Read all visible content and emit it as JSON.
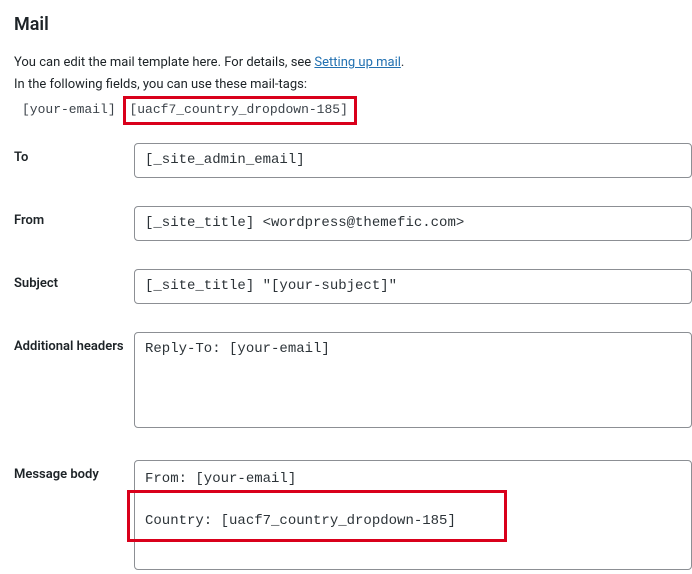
{
  "title": "Mail",
  "intro": {
    "prefix": "You can edit the mail template here. For details, see ",
    "link_text": "Setting up mail",
    "suffix": "."
  },
  "tagline": "In the following fields, you can use these mail-tags:",
  "mail_tags": {
    "tag1": "[your-email]",
    "tag2": "[uacf7_country_dropdown-185]"
  },
  "fields": {
    "to": {
      "label": "To",
      "value": "[_site_admin_email]"
    },
    "from": {
      "label": "From",
      "value": "[_site_title] <wordpress@themefic.com>"
    },
    "subject": {
      "label": "Subject",
      "value": "[_site_title] \"[your-subject]\""
    },
    "headers": {
      "label": "Additional headers",
      "value": "Reply-To: [your-email]"
    },
    "body": {
      "label": "Message body",
      "value": "From: [your-email]\n\nCountry: [uacf7_country_dropdown-185]"
    }
  }
}
